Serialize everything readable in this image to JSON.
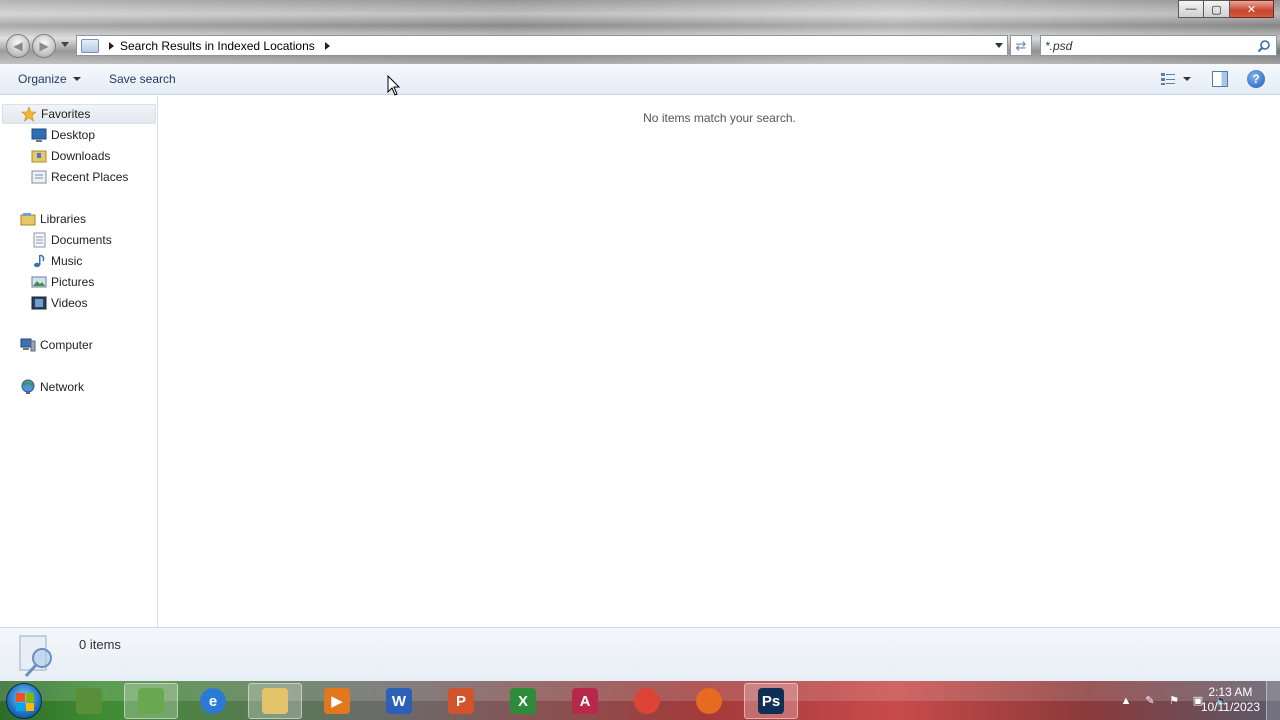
{
  "window": {
    "controls": {
      "minimize": "—",
      "maximize": "▢",
      "close": "✕"
    }
  },
  "address_bar": {
    "crumbs": [
      "Search Results in Indexed Locations"
    ]
  },
  "search": {
    "value": "*.psd"
  },
  "toolbar": {
    "organize_label": "Organize",
    "save_search_label": "Save search",
    "help_label": "?"
  },
  "navigation": {
    "favorites": {
      "label": "Favorites",
      "items": [
        "Desktop",
        "Downloads",
        "Recent Places"
      ]
    },
    "libraries": {
      "label": "Libraries",
      "items": [
        "Documents",
        "Music",
        "Pictures",
        "Videos"
      ]
    },
    "computer": {
      "label": "Computer"
    },
    "network": {
      "label": "Network"
    }
  },
  "content": {
    "empty_message": "No items match your search."
  },
  "details": {
    "item_count": "0 items"
  },
  "taskbar": {
    "apps": [
      {
        "name": "program-manager",
        "glyph": "",
        "color": "#5a8f3a"
      },
      {
        "name": "users",
        "glyph": "",
        "color": "#6aa84f"
      },
      {
        "name": "internet-explorer",
        "glyph": "e",
        "color": "#2b7bd6"
      },
      {
        "name": "windows-explorer",
        "glyph": "",
        "color": "#e3c46a"
      },
      {
        "name": "media-player",
        "glyph": "▶",
        "color": "#e2781e"
      },
      {
        "name": "word",
        "glyph": "W",
        "color": "#2b5fb8"
      },
      {
        "name": "powerpoint",
        "glyph": "P",
        "color": "#d2532b"
      },
      {
        "name": "excel",
        "glyph": "X",
        "color": "#2e8b3a"
      },
      {
        "name": "access",
        "glyph": "A",
        "color": "#b7284a"
      },
      {
        "name": "chrome",
        "glyph": "",
        "color": "#db4437"
      },
      {
        "name": "firefox",
        "glyph": "",
        "color": "#e66a1f"
      },
      {
        "name": "photoshop",
        "glyph": "Ps",
        "color": "#0f2e55"
      }
    ],
    "clock": {
      "time": "2:13 AM",
      "date": "10/11/2023"
    }
  }
}
